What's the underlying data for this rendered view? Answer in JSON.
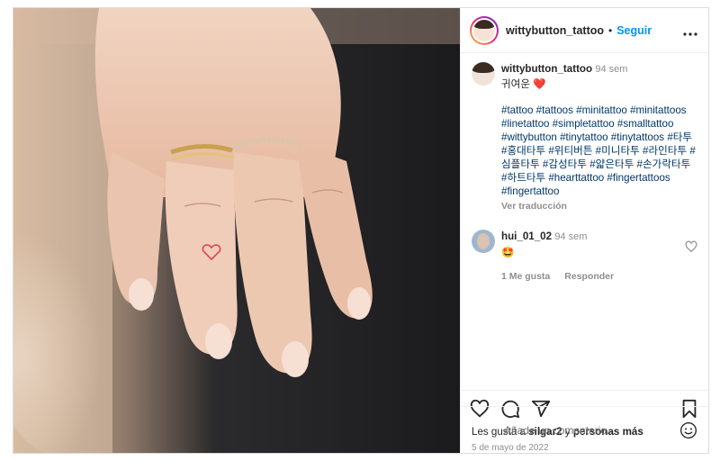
{
  "header": {
    "username": "wittybutton_tattoo",
    "separator": "•",
    "follow_label": "Seguir",
    "more_label": "•••"
  },
  "caption": {
    "username": "wittybutton_tattoo",
    "time": "94 sem",
    "text": "귀여운",
    "emoji": "❤️",
    "hashtags": "#tattoo #tattoos #minitattoo #minitattoos #linetattoo #simpletattoo #smalltattoo #wittybutton #tinytattoo #tinytattoos #타투 #홍대타투 #위티버튼 #미니타투 #라인타투 #심플타투 #감성타투 #얇은타투 #손가락타투 #하트타투 #hearttattoo #fingertattoos #fingertattoo",
    "translate_label": "Ver traducción"
  },
  "comment": {
    "username": "hui_01_02",
    "time": "94 sem",
    "emoji": "🤩",
    "likes_label": "1 Me gusta",
    "reply_label": "Responder"
  },
  "actions": {
    "like_icon": "heart-outline-icon",
    "comment_icon": "comment-bubble-icon",
    "share_icon": "paper-plane-icon",
    "save_icon": "bookmark-icon"
  },
  "likes": {
    "prefix": "Les gusta a ",
    "user": "silgar2",
    "middle": " y ",
    "suffix": "personas más"
  },
  "date": "5 de mayo de 2022",
  "composer": {
    "placeholder": "Añade un comentario..."
  },
  "colors": {
    "accent": "#0095f6",
    "hashtag": "#00376b",
    "muted": "#8e8e8e",
    "heart": "#ed4956"
  }
}
